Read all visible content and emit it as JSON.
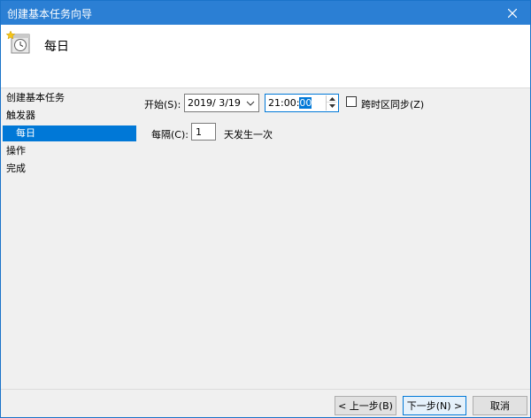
{
  "window": {
    "title": "创建基本任务向导"
  },
  "header": {
    "title": "每日"
  },
  "sidebar": {
    "items": [
      {
        "label": "创建基本任务"
      },
      {
        "label": "触发器"
      },
      {
        "label": "每日"
      },
      {
        "label": "操作"
      },
      {
        "label": "完成"
      }
    ]
  },
  "form": {
    "start_label": "开始(S):",
    "date_value": "2019/  3/19",
    "time_value_prefix": "21:00:",
    "time_value_selected": "00",
    "sync_timezone_label": "跨时区同步(Z)",
    "sync_timezone_checked": false,
    "recur_label": "每隔(C):",
    "recur_value": "1",
    "recur_suffix": "天发生一次"
  },
  "buttons": {
    "back": "< 上一步(B)",
    "next": "下一步(N) >",
    "cancel": "取消"
  },
  "colors": {
    "titlebar": "#2b7fd4",
    "selection": "#0078d7"
  }
}
